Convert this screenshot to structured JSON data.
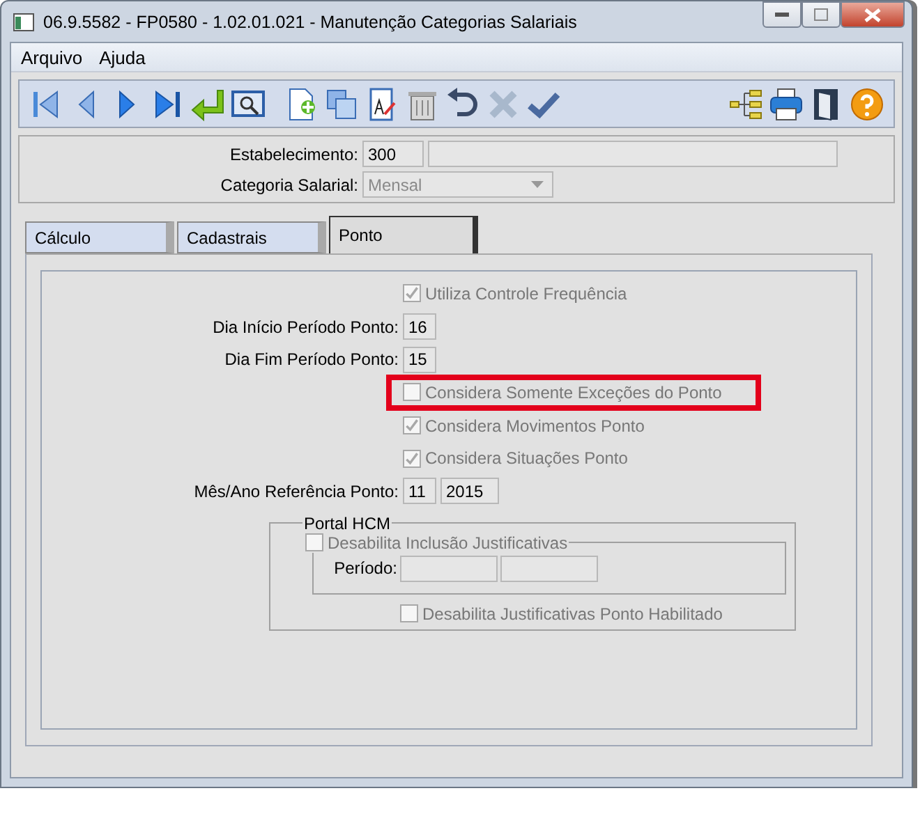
{
  "window": {
    "title": "06.9.5582 - FP0580 - 1.02.01.021 - Manutenção Categorias Salariais"
  },
  "menu": [
    {
      "label": "Arquivo"
    },
    {
      "label": "Ajuda"
    }
  ],
  "header": {
    "estabelecimento": {
      "label": "Estabelecimento:",
      "code": "300"
    },
    "categoria": {
      "label": "Categoria Salarial:",
      "value": "Mensal"
    }
  },
  "tabs": [
    {
      "label": "Cálculo",
      "selected": false
    },
    {
      "label": "Cadastrais",
      "selected": false
    },
    {
      "label": "Ponto",
      "selected": true
    }
  ],
  "ponto": [
    {
      "kind": "checkbox",
      "label": "Utiliza Controle Frequência",
      "checked": true,
      "disabled": true,
      "highlighted": false
    },
    {
      "kind": "field",
      "label": "Dia Início Período Ponto:",
      "values": [
        "16"
      ]
    },
    {
      "kind": "field",
      "label": "Dia Fim Período Ponto:",
      "values": [
        "15"
      ]
    },
    {
      "kind": "checkbox",
      "label": "Considera Somente Exceções do Ponto",
      "checked": false,
      "disabled": true,
      "highlighted": true
    },
    {
      "kind": "checkbox",
      "label": "Considera Movimentos Ponto",
      "checked": true,
      "disabled": true,
      "highlighted": false
    },
    {
      "kind": "checkbox",
      "label": "Considera Situações Ponto",
      "checked": true,
      "disabled": true,
      "highlighted": false
    },
    {
      "kind": "field",
      "label": "Mês/Ano Referência Ponto:",
      "values": [
        "11",
        "2015"
      ]
    }
  ],
  "portal": {
    "title": "Portal HCM",
    "group_checkbox": {
      "label": "Desabilita Inclusão Justificativas",
      "checked": false,
      "disabled": true
    },
    "periodo_label": "Período:",
    "bottom_checkbox": {
      "label": "Desabilita Justificativas Ponto Habilitado",
      "checked": false,
      "disabled": true
    }
  }
}
